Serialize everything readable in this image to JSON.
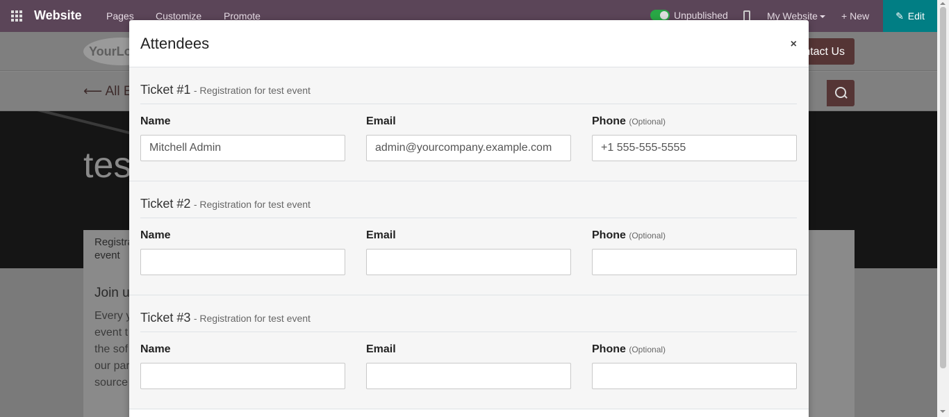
{
  "topbar": {
    "brand": "Website",
    "menus": [
      "Pages",
      "Customize",
      "Promote"
    ],
    "publish_status": "Unpublished",
    "website_switcher": "My Website",
    "new_label": "New",
    "edit_label": "Edit"
  },
  "background": {
    "logo_text": "YourLo",
    "contact_label": "ntact Us",
    "back_label": "All E",
    "hero_title": "tes",
    "registration_text": "Registra event",
    "join_heading": "Join u",
    "paragraph": "Every y event t the sof our par source"
  },
  "modal": {
    "title": "Attendees",
    "close": "×",
    "tickets": [
      {
        "number": "Ticket #1",
        "description": "- Registration for test event",
        "name_label": "Name",
        "email_label": "Email",
        "phone_label": "Phone",
        "optional_label": "(Optional)",
        "name_value": "Mitchell Admin",
        "email_value": "admin@yourcompany.example.com",
        "phone_value": "+1 555-555-5555"
      },
      {
        "number": "Ticket #2",
        "description": "- Registration for test event",
        "name_label": "Name",
        "email_label": "Email",
        "phone_label": "Phone",
        "optional_label": "(Optional)",
        "name_value": "",
        "email_value": "",
        "phone_value": ""
      },
      {
        "number": "Ticket #3",
        "description": "- Registration for test event",
        "name_label": "Name",
        "email_label": "Email",
        "phone_label": "Phone",
        "optional_label": "(Optional)",
        "name_value": "",
        "email_value": "",
        "phone_value": ""
      }
    ]
  },
  "colors": {
    "topbar": "#5b4558",
    "edit_button": "#017e84",
    "toggle_on": "#28a745",
    "primary_brown": "#553535"
  }
}
